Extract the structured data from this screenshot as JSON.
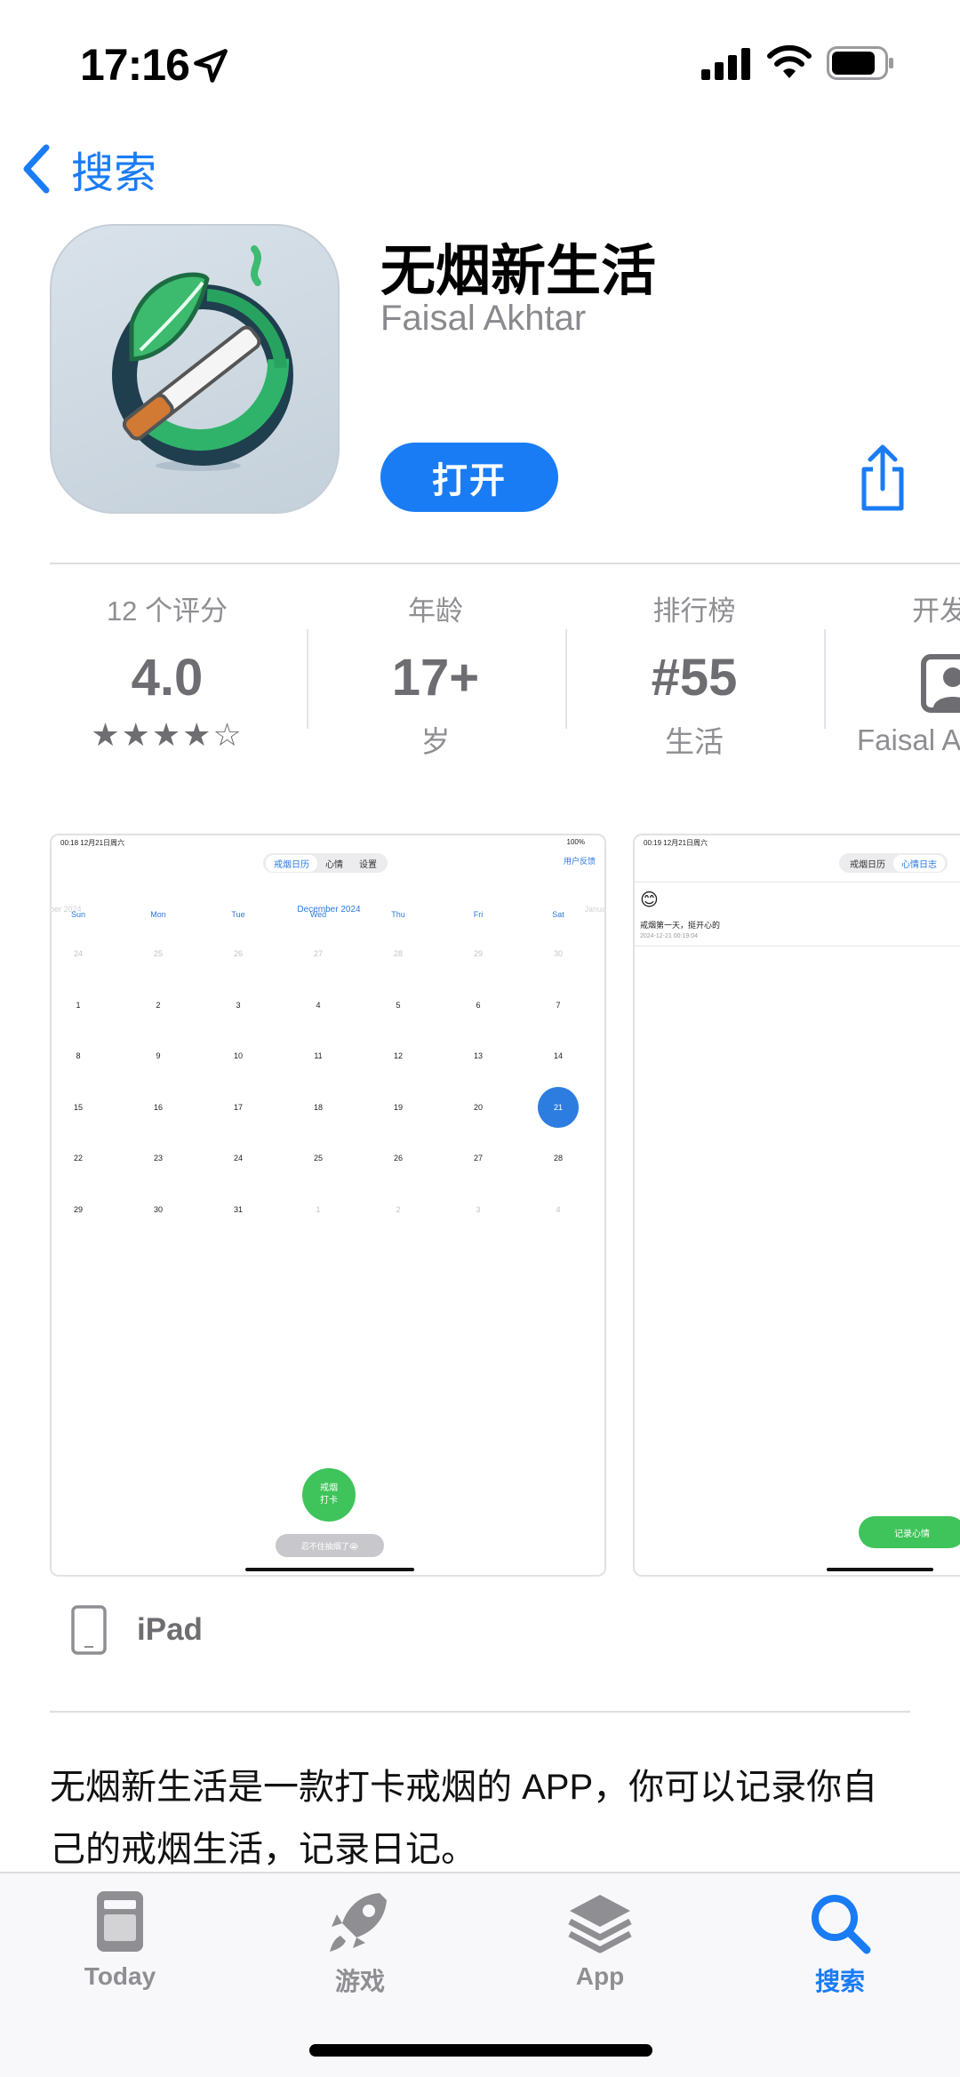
{
  "status_bar": {
    "time": "17:16"
  },
  "nav": {
    "back_label": "搜索"
  },
  "app": {
    "title": "无烟新生活",
    "developer": "Faisal Akhtar",
    "open_label": "打开"
  },
  "info": {
    "ratings": {
      "label": "12 个评分",
      "value": "4.0",
      "stars": "★★★★☆",
      "rating": 4.0
    },
    "age": {
      "label": "年龄",
      "value": "17+",
      "sub": "岁"
    },
    "chart": {
      "label": "排行榜",
      "value": "#55",
      "sub": "生活"
    },
    "developer": {
      "label": "开发",
      "sub": "Faisal A"
    }
  },
  "screenshot1": {
    "status_time": "00:18   12月21日周六",
    "status_right": "100%",
    "tabs": [
      "戒烟日历",
      "心情",
      "设置"
    ],
    "active_tab": 0,
    "link": "用户反馈",
    "month": "December 2024",
    "prev_month": "ber 2024",
    "next_month": "Janua",
    "weekdays": [
      "Sun",
      "Mon",
      "Tue",
      "Wed",
      "Thu",
      "Fri",
      "Sat"
    ],
    "weeks": [
      [
        "24",
        "25",
        "26",
        "27",
        "28",
        "29",
        "30"
      ],
      [
        "1",
        "2",
        "3",
        "4",
        "5",
        "6",
        "7"
      ],
      [
        "8",
        "9",
        "10",
        "11",
        "12",
        "13",
        "14"
      ],
      [
        "15",
        "16",
        "17",
        "18",
        "19",
        "20",
        "21"
      ],
      [
        "22",
        "23",
        "24",
        "25",
        "26",
        "27",
        "28"
      ],
      [
        "29",
        "30",
        "31",
        "1",
        "2",
        "3",
        "4"
      ]
    ],
    "today": "21",
    "checkin_label": "戒烟打卡",
    "checkin_line1": "戒烟",
    "checkin_line2": "打卡",
    "smoked_label": "忍不住抽烟了😭"
  },
  "screenshot2": {
    "status_time": "00:19   12月21日周六",
    "tabs": [
      "戒烟日历",
      "心情日志"
    ],
    "active_tab": 1,
    "emoji": "😊",
    "entry_text": "戒烟第一天，挺开心的",
    "entry_time": "2024-12-21 00:19:04",
    "record_label": "记录心情"
  },
  "device": {
    "label": "iPad"
  },
  "description": "无烟新生活是一款打卡戒烟的 APP，你可以记录你自己的戒烟生活，记录日记。",
  "tabs": [
    {
      "label": "Today",
      "icon": "today-icon"
    },
    {
      "label": "游戏",
      "icon": "rocket-icon"
    },
    {
      "label": "App",
      "icon": "app-stack-icon"
    },
    {
      "label": "搜索",
      "icon": "search-icon",
      "active": true
    }
  ],
  "colors": {
    "accent": "#1a7cf5",
    "green": "#3ec45a"
  }
}
